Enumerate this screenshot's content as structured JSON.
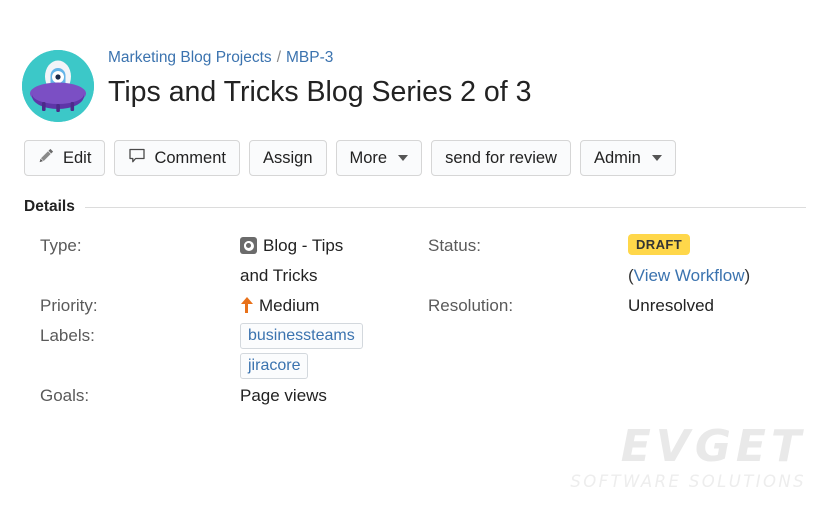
{
  "header": {
    "avatar_icon": "ufo-alien-avatar",
    "breadcrumb": {
      "project": "Marketing Blog Projects",
      "separator": "/",
      "issue_key": "MBP-3"
    },
    "title": "Tips and Tricks Blog Series 2 of 3"
  },
  "toolbar": {
    "edit_label": "Edit",
    "edit_icon": "pencil-icon",
    "comment_label": "Comment",
    "comment_icon": "speech-bubble-icon",
    "assign_label": "Assign",
    "more_label": "More",
    "send_for_review_label": "send for review",
    "admin_label": "Admin"
  },
  "details": {
    "section_title": "Details",
    "type": {
      "label": "Type:",
      "value": "Blog - Tips and Tricks",
      "icon": "blog-type-icon"
    },
    "status": {
      "label": "Status:",
      "badge": "DRAFT",
      "badge_color": "#ffd74a",
      "workflow_prefix": "(",
      "workflow_link": "View Workflow",
      "workflow_suffix": ")"
    },
    "priority": {
      "label": "Priority:",
      "value": "Medium",
      "icon": "priority-up-arrow-icon",
      "icon_color": "#e8711a"
    },
    "resolution": {
      "label": "Resolution:",
      "value": "Unresolved"
    },
    "labels": {
      "label": "Labels:",
      "values": [
        "businessteams",
        "jiracore"
      ]
    },
    "goals": {
      "label": "Goals:",
      "value": "Page views"
    }
  },
  "watermark": {
    "main": "EVGET",
    "sub": "SOFTWARE SOLUTIONS"
  }
}
